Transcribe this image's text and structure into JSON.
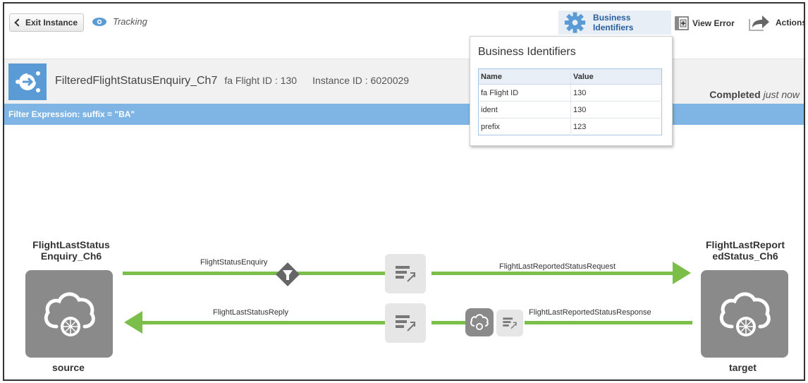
{
  "toolbar": {
    "exit_label": "Exit Instance",
    "tracking_label": "Tracking",
    "business_identifiers_label": "Business Identifiers",
    "view_error_label": "View Error",
    "actions_label": "Actions"
  },
  "instance": {
    "name": "FilteredFlightStatusEnquiry_Ch7",
    "flight_id": "fa Flight ID : 130",
    "instance_id": "Instance ID : 6020029",
    "status": "Completed",
    "status_time": "just now"
  },
  "filter_expression": "Filter Expression: suffix = \"BA\"",
  "popover": {
    "title": "Business Identifiers",
    "columns": [
      "Name",
      "Value"
    ],
    "rows": [
      {
        "name": "fa Flight ID",
        "value": "130"
      },
      {
        "name": "ident",
        "value": "130"
      },
      {
        "name": "prefix",
        "value": "123"
      }
    ]
  },
  "flow": {
    "source_title": "FlightLastStatus\nEnquiry_Ch6",
    "source_caption": "source",
    "target_title": "FlightLastReport\nedStatus_Ch6",
    "target_caption": "target",
    "request_label": "FlightStatusEnquiry",
    "target_request_label": "FlightLastReportedStatusRequest",
    "reply_label": "FlightLastStatusReply",
    "target_response_label": "FlightLastReportedStatusResponse"
  },
  "colors": {
    "accent_blue": "#5b9bd5",
    "filter_bar": "#7fb5e4",
    "flow_green": "#7bbf4a",
    "node_gray": "#8a8a8a"
  }
}
